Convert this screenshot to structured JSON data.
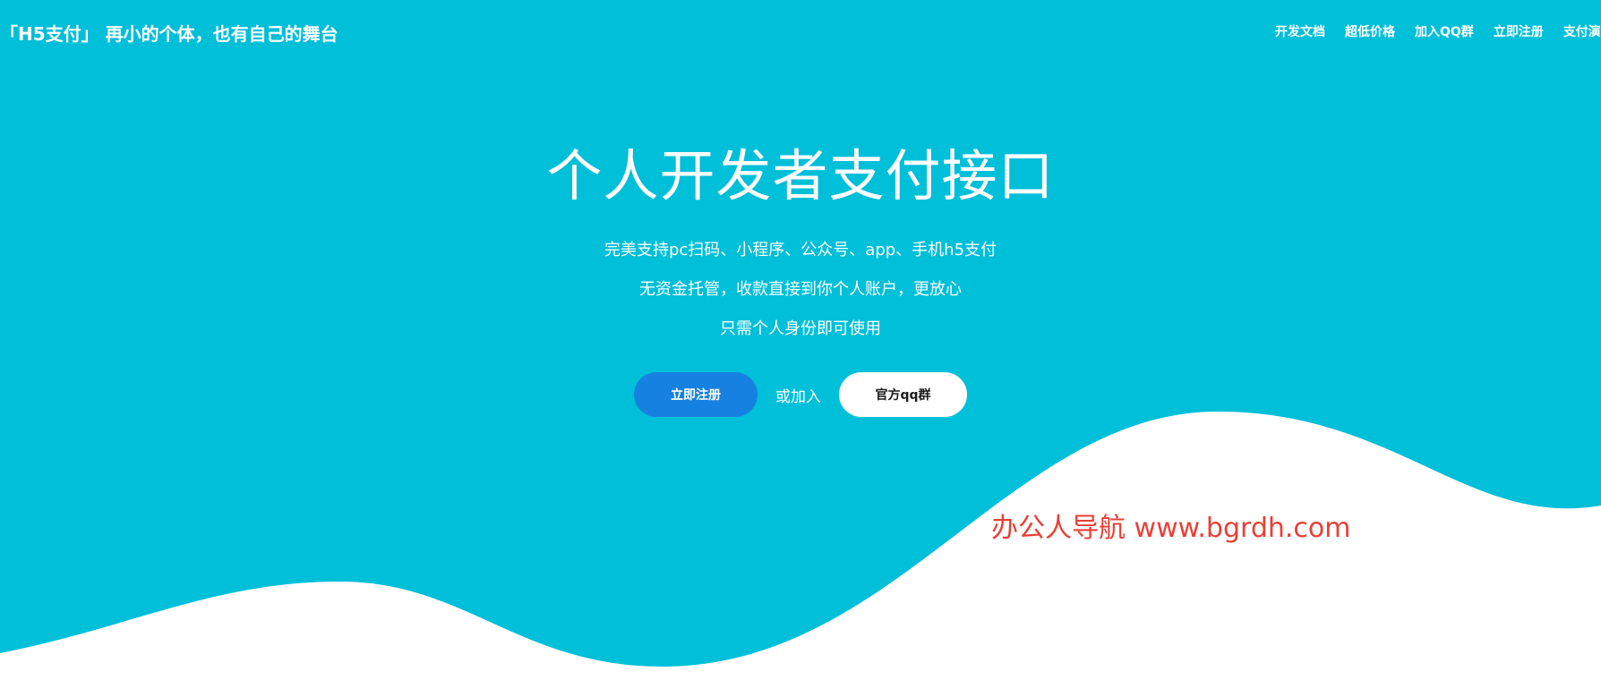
{
  "header": {
    "brand": "「H5支付」 再小的个体，也有自己的舞台",
    "nav": [
      {
        "label": "开发文档"
      },
      {
        "label": "超低价格"
      },
      {
        "label": "加入QQ群"
      },
      {
        "label": "立即注册"
      },
      {
        "label": "支付演示"
      }
    ]
  },
  "hero": {
    "title": "个人开发者支付接口",
    "lines": [
      "完美支持pc扫码、小程序、公众号、app、手机h5支付",
      "无资金托管，收款直接到你个人账户，更放心",
      "只需个人身份即可使用"
    ],
    "register_button": "立即注册",
    "or_text": "或加入",
    "qq_button": "官方qq群"
  },
  "watermark": "办公人导航 www.bgrdh.com",
  "colors": {
    "hero_background": "#00bfd8",
    "register_button": "#1681e0",
    "wave": "#ffffff",
    "watermark": "#e84037"
  }
}
